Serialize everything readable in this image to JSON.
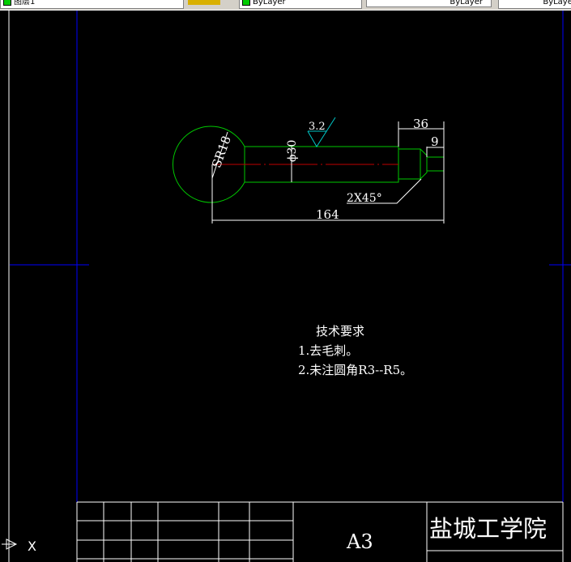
{
  "toolbar": {
    "layer": "图层1",
    "color": "ByLayer",
    "linetype": "ByLayer",
    "lineweight": "ByLayer"
  },
  "drawing": {
    "sr": "SR18",
    "dia": "ϕ30",
    "rough": "3.2",
    "d36": "36",
    "d9": "9",
    "chamfer": "2X45°",
    "d164": "164"
  },
  "notes": {
    "title": "技术要求",
    "line1": "1.去毛刺。",
    "line2": "2.未注圆角R3--R5。"
  },
  "titleblock": {
    "size": "A3",
    "school": "盐城工学院"
  },
  "ucs": {
    "x": "X"
  },
  "colors": {
    "part": "#00c800",
    "dim": "#ffffff",
    "center": "#c00000",
    "frame": "#0000ff",
    "rough": "#00c8c8"
  }
}
